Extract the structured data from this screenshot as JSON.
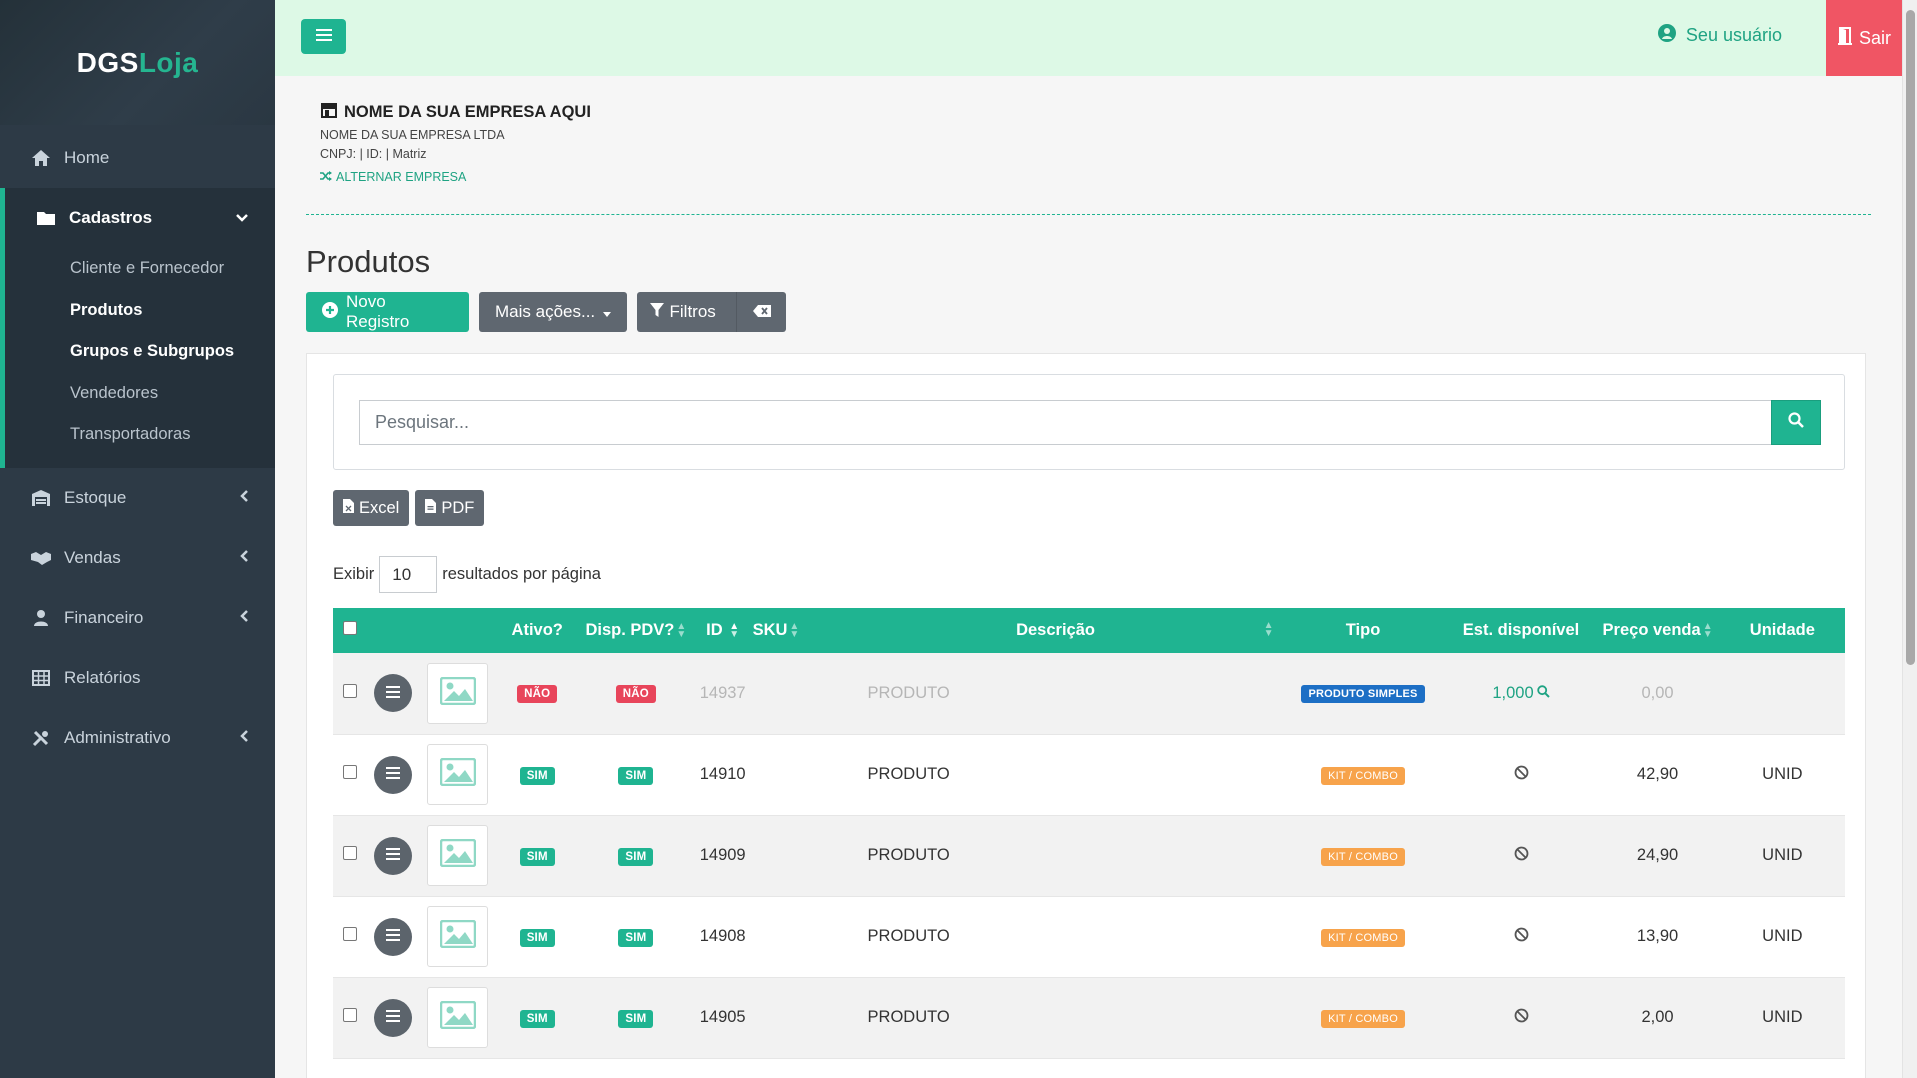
{
  "brand": {
    "part1": "DGS",
    "part2": "Loja"
  },
  "sidebar": {
    "items": [
      {
        "label": "Home",
        "icon": "home-icon"
      },
      {
        "label": "Cadastros",
        "icon": "folder-icon"
      },
      {
        "label": "Estoque",
        "icon": "warehouse-icon"
      },
      {
        "label": "Vendas",
        "icon": "handshake-icon"
      },
      {
        "label": "Financeiro",
        "icon": "user-tie-icon"
      },
      {
        "label": "Relatórios",
        "icon": "table-icon"
      },
      {
        "label": "Administrativo",
        "icon": "tools-icon"
      }
    ],
    "cadastros_sub": [
      "Cliente e Fornecedor",
      "Produtos",
      "Grupos e Subgrupos",
      "Vendedores",
      "Transportadoras"
    ]
  },
  "topbar": {
    "user_label": "Seu usuário",
    "logout_label": "Sair"
  },
  "company": {
    "name": "NOME DA SUA EMPRESA AQUI",
    "legal": "NOME DA SUA EMPRESA LTDA",
    "cnpj": "CNPJ: | ID: | Matriz",
    "switch_label": "ALTERNAR EMPRESA"
  },
  "page": {
    "title": "Produtos",
    "new_button": "Novo Registro",
    "more_actions": "Mais ações...",
    "filters": "Filtros"
  },
  "search": {
    "placeholder": "Pesquisar..."
  },
  "export": {
    "excel": "Excel",
    "pdf": "PDF"
  },
  "perpage": {
    "prefix": "Exibir",
    "value": "10",
    "suffix": "resultados por página"
  },
  "table": {
    "headers": {
      "ativo": "Ativo?",
      "disp": "Disp. PDV?",
      "id": "ID",
      "sku": "SKU",
      "descricao": "Descrição",
      "tipo": "Tipo",
      "estoque": "Est. disponível",
      "preco": "Preço venda",
      "unidade": "Unidade"
    },
    "rows": [
      {
        "ativo": "NÃO",
        "disp": "NÃO",
        "id": "14937",
        "sku": "",
        "descricao": "PRODUTO",
        "tipo": "PRODUTO SIMPLES",
        "estoque": "1,000",
        "preco": "0,00",
        "unidade": ""
      },
      {
        "ativo": "SIM",
        "disp": "SIM",
        "id": "14910",
        "sku": "",
        "descricao": "PRODUTO",
        "tipo": "KIT / COMBO",
        "estoque": "",
        "preco": "42,90",
        "unidade": "UNID"
      },
      {
        "ativo": "SIM",
        "disp": "SIM",
        "id": "14909",
        "sku": "",
        "descricao": "PRODUTO",
        "tipo": "KIT / COMBO",
        "estoque": "",
        "preco": "24,90",
        "unidade": "UNID"
      },
      {
        "ativo": "SIM",
        "disp": "SIM",
        "id": "14908",
        "sku": "",
        "descricao": "PRODUTO",
        "tipo": "KIT / COMBO",
        "estoque": "",
        "preco": "13,90",
        "unidade": "UNID"
      },
      {
        "ativo": "SIM",
        "disp": "SIM",
        "id": "14905",
        "sku": "",
        "descricao": "PRODUTO",
        "tipo": "KIT / COMBO",
        "estoque": "",
        "preco": "2,00",
        "unidade": "UNID"
      }
    ]
  },
  "colors": {
    "accent": "#1fb491",
    "sidebar": "#2d3a46",
    "topbar": "#ddf9e6",
    "danger": "#f05564",
    "info": "#1d6fc5",
    "warning": "#f7a34b"
  }
}
